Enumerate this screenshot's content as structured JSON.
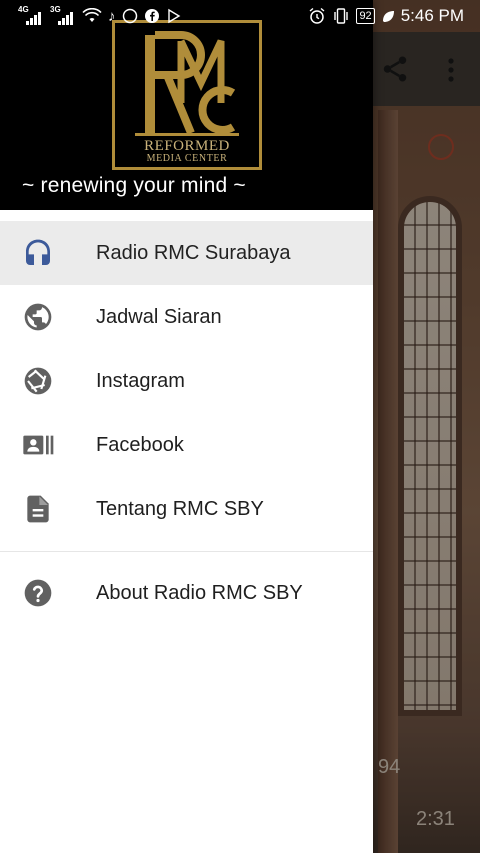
{
  "status_bar": {
    "network_1": "4G",
    "network_2": "3G",
    "battery": "92",
    "time": "5:46 PM"
  },
  "background_app": {
    "track_number": "94",
    "elapsed_time": "2:31",
    "icons": [
      "share-icon",
      "more-vert-icon"
    ]
  },
  "drawer": {
    "logo": {
      "monogram": "RMC",
      "line1": "REFORMED",
      "line2": "MEDIA CENTER",
      "color": "#b08d3a"
    },
    "tagline": "~ renewing your mind ~",
    "menu_items": [
      {
        "label": "Radio RMC Surabaya",
        "icon": "headset-icon",
        "active": true
      },
      {
        "label": "Jadwal Siaran",
        "icon": "globe-icon",
        "active": false
      },
      {
        "label": "Instagram",
        "icon": "camera-shutter-icon",
        "active": false
      },
      {
        "label": "Facebook",
        "icon": "contact-card-icon",
        "active": false
      },
      {
        "label": "Tentang RMC SBY",
        "icon": "document-icon",
        "active": false
      }
    ],
    "secondary_items": [
      {
        "label": "About Radio RMC SBY",
        "icon": "help-icon"
      }
    ],
    "accent_color": "#3c5a9a",
    "icon_color": "#616161"
  }
}
